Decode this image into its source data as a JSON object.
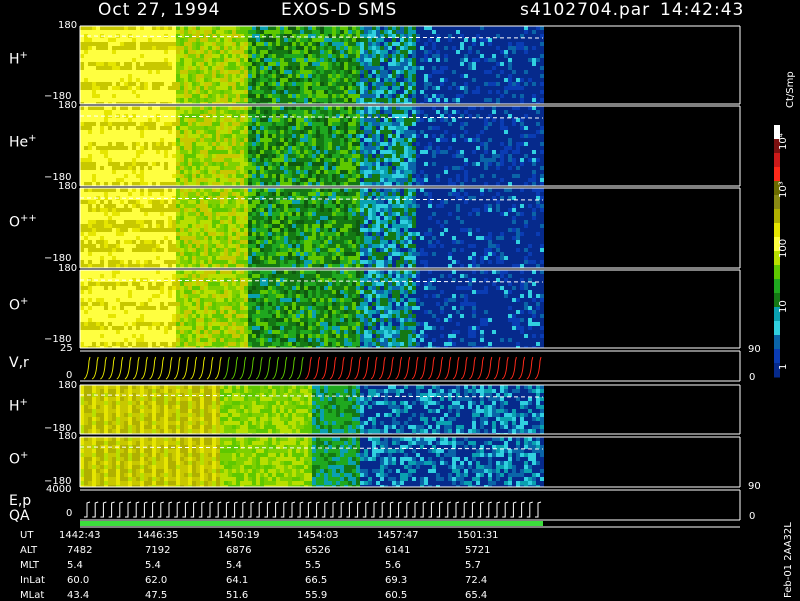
{
  "header": {
    "date": "Oct 27, 1994",
    "instrument": "EXOS-D SMS",
    "file": "s4102704.par",
    "time": "14:42:43"
  },
  "panels": [
    {
      "id": "h-plus",
      "label": "H",
      "sup": "+",
      "top": "180",
      "bottom": "−180"
    },
    {
      "id": "he-plus",
      "label": "He",
      "sup": "+",
      "top": "180",
      "bottom": "−180"
    },
    {
      "id": "o-plusplus",
      "label": "O",
      "sup": "++",
      "top": "180",
      "bottom": "−180"
    },
    {
      "id": "o-plus",
      "label": "O",
      "sup": "+",
      "top": "180",
      "bottom": "−180"
    },
    {
      "id": "vr",
      "label": "V,r",
      "sup": "",
      "top": "25",
      "bottom": "0"
    },
    {
      "id": "h-plus-2",
      "label": "H",
      "sup": "+",
      "top": "180",
      "bottom": "−180"
    },
    {
      "id": "o-plus-2",
      "label": "O",
      "sup": "+",
      "top": "180",
      "bottom": "−180"
    },
    {
      "id": "ep",
      "label": "E,p",
      "sup": "",
      "top": "4000",
      "bottom": "0"
    }
  ],
  "qa_label": "QA",
  "right_axis": {
    "vr_top": "90",
    "vr_bottom": "0",
    "ep_top": "90",
    "ep_bottom": "0"
  },
  "colorbar": {
    "unit": "Ct/Smp",
    "ticks": [
      "10⁴",
      "10³",
      "100",
      "10",
      "1"
    ],
    "colors": [
      "#ffffff",
      "#7a1010",
      "#cc1a1a",
      "#ff2a1a",
      "#6b6b00",
      "#8a8a14",
      "#b0b000",
      "#e6e600",
      "#ffff40",
      "#b8e000",
      "#5ec800",
      "#1fa81f",
      "#147814",
      "#0aa0b0",
      "#30d0e0",
      "#0a64a8",
      "#0a3cb4",
      "#062a8c"
    ]
  },
  "chart_data": {
    "type": "heatmap",
    "title": "Oct 27, 1994   EXOS-D SMS",
    "x_label": "UT",
    "x_ticks": [
      "1442:43",
      "1446:35",
      "1450:19",
      "1454:03",
      "1457:47",
      "1501:31"
    ],
    "x_range_minutes": [
      0,
      19.5
    ],
    "data_end_minutes": 19.5,
    "y_range": [
      -180,
      180
    ],
    "color_scale": "log",
    "color_range": [
      1,
      10000
    ],
    "series": [
      {
        "name": "H+",
        "regime": [
          "high",
          "high",
          "mid",
          "mid",
          "low",
          "low"
        ]
      },
      {
        "name": "He+",
        "regime": [
          "high",
          "high",
          "mid",
          "mid",
          "low",
          "low"
        ]
      },
      {
        "name": "O++",
        "regime": [
          "high",
          "high",
          "mid",
          "mid",
          "low",
          "low"
        ]
      },
      {
        "name": "O+",
        "regime": [
          "high",
          "high",
          "mid",
          "mid",
          "low",
          "low"
        ]
      }
    ]
  },
  "ephemeris": [
    {
      "name": "UT",
      "values": [
        "1442:43",
        "1446:35",
        "1450:19",
        "1454:03",
        "1457:47",
        "1501:31"
      ]
    },
    {
      "name": "ALT",
      "values": [
        "7482",
        "7192",
        "6876",
        "6526",
        "6141",
        "5721"
      ]
    },
    {
      "name": "MLT",
      "values": [
        "5.4",
        "5.4",
        "5.4",
        "5.5",
        "5.6",
        "5.7"
      ]
    },
    {
      "name": "InLat",
      "values": [
        "60.0",
        "62.0",
        "64.1",
        "66.5",
        "69.3",
        "72.4"
      ]
    },
    {
      "name": "MLat",
      "values": [
        "43.4",
        "47.5",
        "51.6",
        "55.9",
        "60.5",
        "65.4"
      ]
    }
  ],
  "footer_tag": "Feb-01 2AA32L"
}
